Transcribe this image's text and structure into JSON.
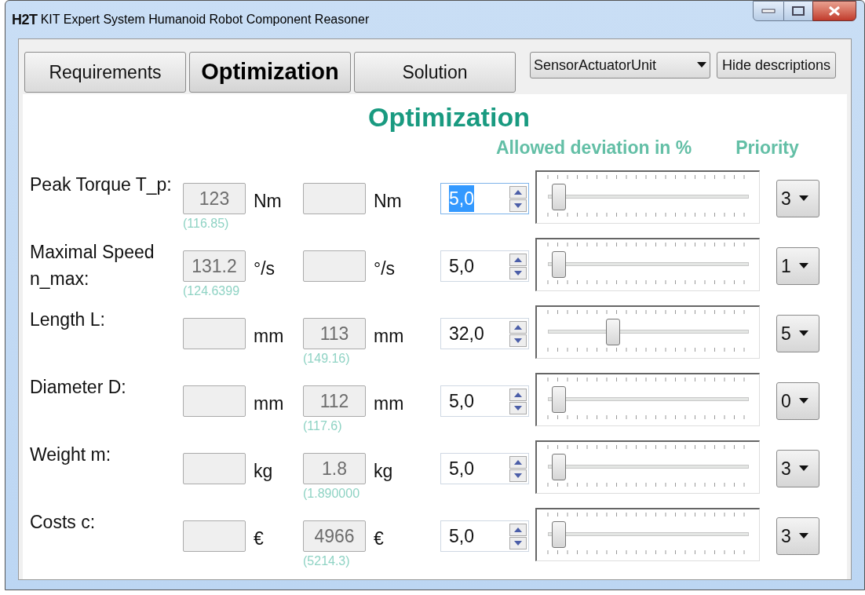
{
  "window": {
    "logo": "H2T",
    "title": "KIT Expert System Humanoid Robot Component Reasoner"
  },
  "tabs": [
    {
      "label": "Requirements",
      "selected": false
    },
    {
      "label": "Optimization",
      "selected": true
    },
    {
      "label": "Solution",
      "selected": false
    }
  ],
  "component_select": {
    "value": "SensorActuatorUnit"
  },
  "hide_button": {
    "label": "Hide descriptions"
  },
  "heading": "Optimization",
  "columns": {
    "deviation": "Allowed deviation in %",
    "priority": "Priority"
  },
  "rows": [
    {
      "label": "Peak Torque T_p:",
      "min": {
        "value": "123",
        "hint": "(116.85)"
      },
      "min_unit": "Nm",
      "max": {},
      "max_unit": "Nm",
      "deviation": "5,0",
      "text_selected": true,
      "level": 0.05,
      "priority": "3"
    },
    {
      "label": "Maximal Speed n_max:",
      "min": {
        "value": "131.2",
        "hint": "(124.6399"
      },
      "min_unit": "°/s",
      "max": {},
      "max_unit": "°/s",
      "deviation": "5,0",
      "text_selected": false,
      "level": 0.05,
      "priority": "1"
    },
    {
      "label": "Length L:",
      "min": {},
      "min_unit": "mm",
      "max": {
        "value": "113",
        "hint": "(149.16)"
      },
      "max_unit": "mm",
      "deviation": "32,0",
      "text_selected": false,
      "level": 0.32,
      "priority": "5"
    },
    {
      "label": "Diameter D:",
      "min": {},
      "min_unit": "mm",
      "max": {
        "value": "112",
        "hint": "(117.6)"
      },
      "max_unit": "mm",
      "deviation": "5,0",
      "text_selected": false,
      "level": 0.05,
      "priority": "0"
    },
    {
      "label": "Weight m:",
      "min": {},
      "min_unit": "kg",
      "max": {
        "value": "1.8",
        "hint": "(1.890000"
      },
      "max_unit": "kg",
      "deviation": "5,0",
      "text_selected": false,
      "level": 0.05,
      "priority": "3"
    },
    {
      "label": "Costs c:",
      "min": {},
      "min_unit": "€",
      "max": {
        "value": "4966",
        "hint": "(5214.3)"
      },
      "max_unit": "€",
      "deviation": "5,0",
      "text_selected": false,
      "level": 0.05,
      "priority": "3"
    }
  ]
}
